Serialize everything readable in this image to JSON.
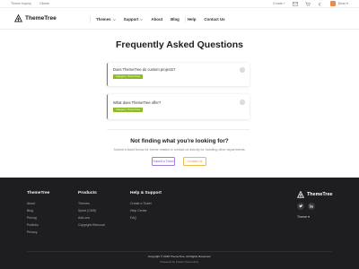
{
  "utility_bar": {
    "links": [
      "Theme Inquiry",
      "Clients"
    ],
    "create_label": "Create +",
    "user_name": "Brian ▾"
  },
  "nav": {
    "brand": "ThemeTree",
    "menu": [
      {
        "label": "Themes",
        "has_caret": true
      },
      {
        "label": "Support",
        "has_caret": true
      },
      {
        "label": "About",
        "has_caret": false
      },
      {
        "label": "Blog",
        "has_caret": false
      },
      {
        "label": "Help",
        "has_caret": false
      },
      {
        "label": "Contact Us",
        "has_caret": false
      }
    ]
  },
  "main": {
    "title": "Frequently Asked Questions",
    "faqs": [
      {
        "question": "Does ThemeTree do custom projects?",
        "category": "Category: ThemeTree",
        "toggle": "+"
      },
      {
        "question": "What does ThemeTree offer?",
        "category": "Category: ThemeTree",
        "toggle": "+"
      }
    ],
    "not_found_title": "Not finding what you're looking for?",
    "not_found_text": "Submit a ticket below for theme related or contact us directly for handling other departments.",
    "submit_label": "Submit a Ticket",
    "contact_label": "Contact Us"
  },
  "footer": {
    "columns": [
      {
        "title": "ThemeTree",
        "links": [
          "About",
          "Blog",
          "Pricing",
          "Portfolio",
          "Privacy"
        ]
      },
      {
        "title": "Products",
        "links": [
          "Themes",
          "Sprint (CMS)",
          "Add-ons",
          "Copyright Removal"
        ]
      },
      {
        "title": "Help & Support",
        "links": [
          "Create a Ticket",
          "Help Center",
          "FAQ"
        ]
      }
    ],
    "brand": "ThemeTree",
    "theme_select": "Theme ▾",
    "copyright": "Copyright © 2018 ThemeTree. All Rights Reserved.",
    "powered": "Powered by Kreani Community"
  },
  "colors": {
    "accent_purple": "#8a5cd0",
    "category_green": "#8dba26",
    "contact_orange": "#e79d1b",
    "footer_bg": "#1e1e20"
  }
}
